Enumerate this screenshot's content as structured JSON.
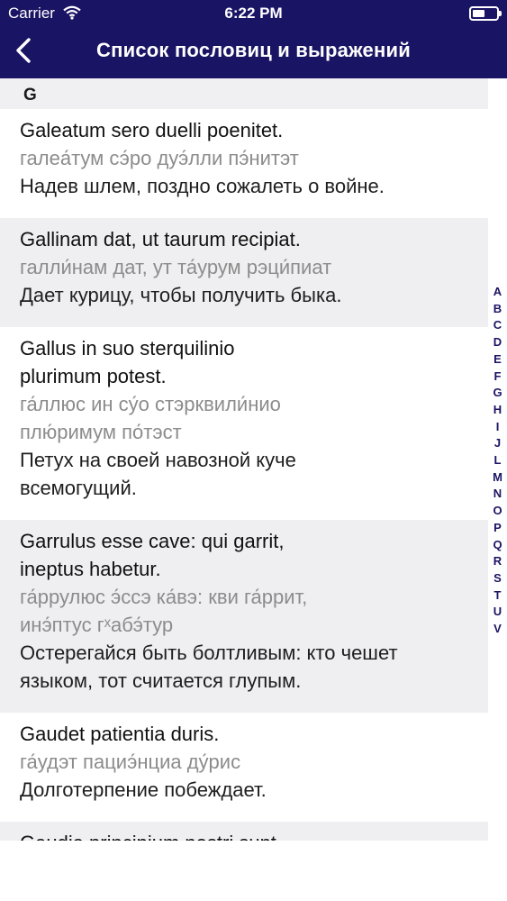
{
  "status_bar": {
    "carrier": "Carrier",
    "time": "6:22 PM"
  },
  "nav": {
    "title": "Список пословиц и выражений"
  },
  "section": {
    "letter": "G"
  },
  "entries": [
    {
      "latin": [
        "Galeatum sero duelli poenitet."
      ],
      "pron": [
        "галеа́тум сэ́ро дуэ́лли пэ́нитэт"
      ],
      "trans": [
        "Надев шлем, поздно сожалеть о войне."
      ]
    },
    {
      "latin": [
        "Gallinam dat, ut taurum recipiat."
      ],
      "pron": [
        "галли́нам дат, ут та́урум рэци́пиат"
      ],
      "trans": [
        "Дает курицу, чтобы получить быка."
      ]
    },
    {
      "latin": [
        "Gallus in suo sterquilinio",
        "plurimum potest."
      ],
      "pron": [
        "га́ллюс ин су́о стэрквили́нио",
        "плю́римум по́тэст"
      ],
      "trans": [
        "Петух на своей навозной куче",
        "всемогущий."
      ]
    },
    {
      "latin": [
        "Garrulus esse cave: qui garrit,",
        "ineptus habetur."
      ],
      "pron": [
        "га́ррулюс э́ссэ ка́вэ: кви га́ррит,",
        "инэ́птус гˣабэ́тур"
      ],
      "trans": [
        "Остерегайся быть болтливым: кто чешет",
        "языком, тот считается глупым."
      ]
    },
    {
      "latin": [
        "Gaudet patientia duris."
      ],
      "pron": [
        "га́удэт пациэ́нциа ду́рис"
      ],
      "trans": [
        "Долготерпение побеждает."
      ]
    },
    {
      "latin": [
        "Gaudia principium nostri sunt"
      ],
      "pron": [],
      "trans": []
    }
  ],
  "index_letters": [
    "A",
    "B",
    "C",
    "D",
    "E",
    "F",
    "G",
    "H",
    "I",
    "J",
    "L",
    "M",
    "N",
    "O",
    "P",
    "Q",
    "R",
    "S",
    "T",
    "U",
    "V"
  ]
}
